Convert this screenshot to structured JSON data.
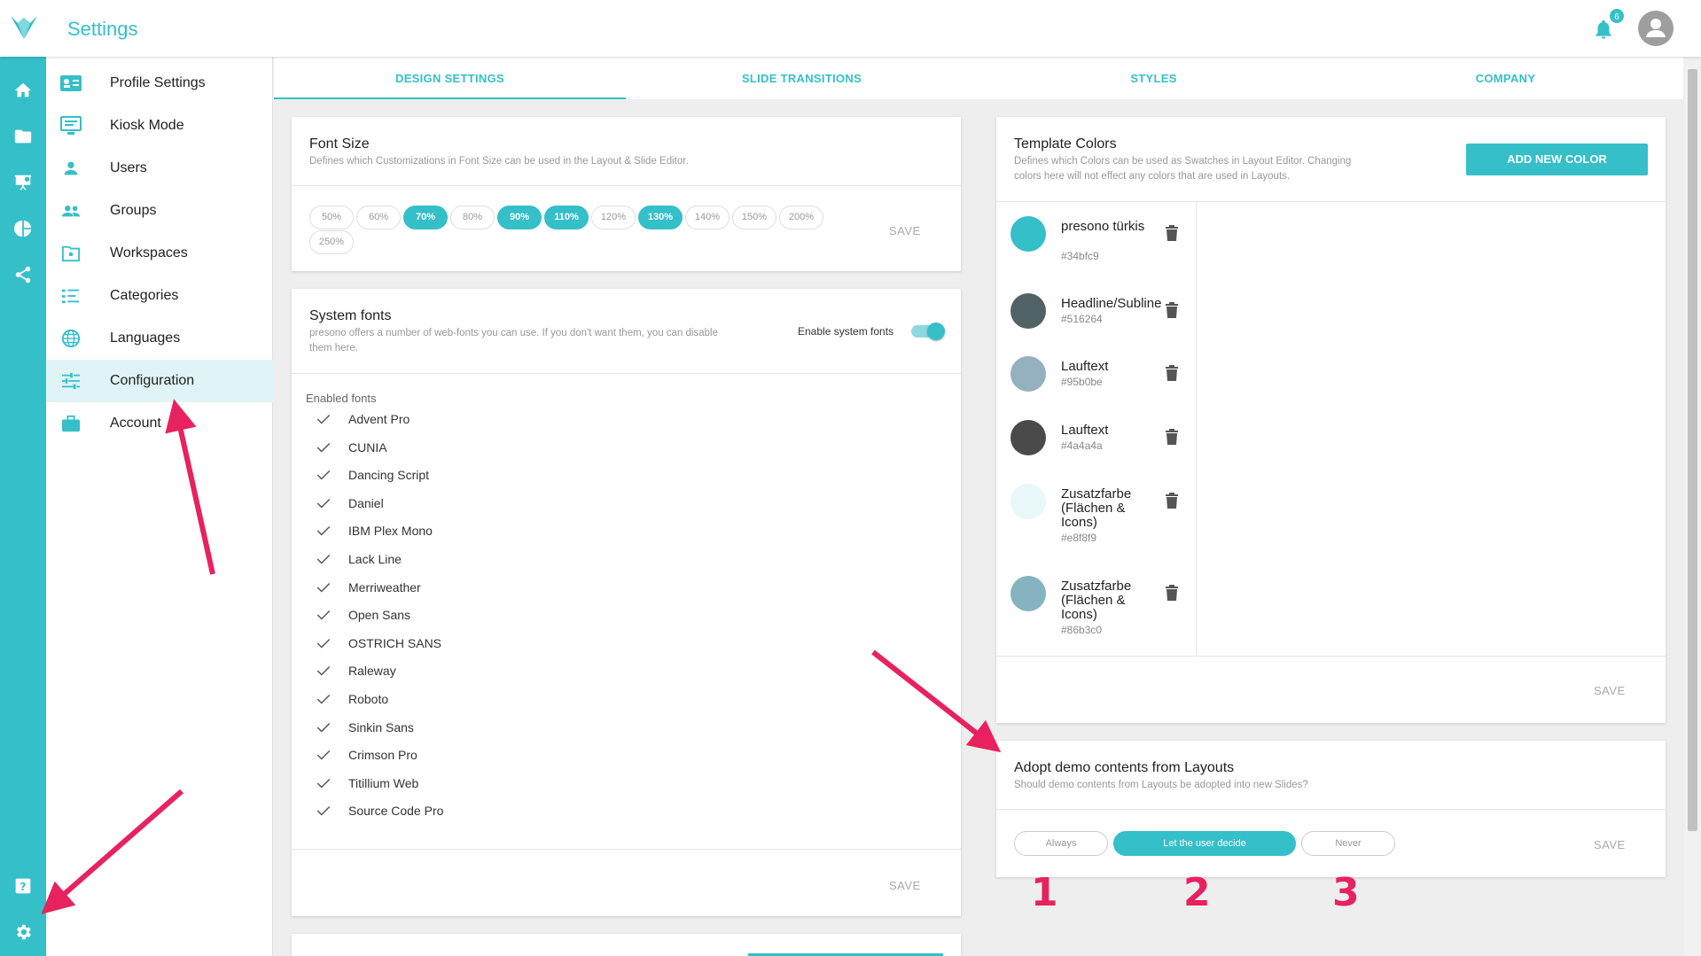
{
  "app": {
    "title": "Settings",
    "notification_count": "6"
  },
  "colors": {
    "accent": "#34bfc9",
    "annotation": "#e8215f"
  },
  "rail": [
    {
      "icon": "home-icon"
    },
    {
      "icon": "folder-icon"
    },
    {
      "icon": "presentation-icon"
    },
    {
      "icon": "pie-chart-icon"
    },
    {
      "icon": "share-icon"
    },
    {
      "icon": "help-icon"
    },
    {
      "icon": "gear-icon"
    }
  ],
  "sidebar": {
    "items": [
      {
        "label": "Profile Settings",
        "icon": "profile-card-icon"
      },
      {
        "label": "Kiosk Mode",
        "icon": "monitor-icon"
      },
      {
        "label": "Users",
        "icon": "user-icon"
      },
      {
        "label": "Groups",
        "icon": "group-icon"
      },
      {
        "label": "Workspaces",
        "icon": "workspace-folder-icon"
      },
      {
        "label": "Categories",
        "icon": "list-icon"
      },
      {
        "label": "Languages",
        "icon": "globe-icon"
      },
      {
        "label": "Configuration",
        "icon": "sliders-icon",
        "active": true
      },
      {
        "label": "Account",
        "icon": "briefcase-icon"
      }
    ]
  },
  "tabs": [
    {
      "label": "DESIGN SETTINGS",
      "active": true
    },
    {
      "label": "SLIDE TRANSITIONS"
    },
    {
      "label": "STYLES"
    },
    {
      "label": "COMPANY"
    }
  ],
  "font_size": {
    "title": "Font Size",
    "subtitle": "Defines which Customizations in Font Size can be used in the Layout & Slide Editor.",
    "options": [
      {
        "label": "50%",
        "on": false
      },
      {
        "label": "60%",
        "on": false
      },
      {
        "label": "70%",
        "on": true
      },
      {
        "label": "80%",
        "on": false
      },
      {
        "label": "90%",
        "on": true
      },
      {
        "label": "110%",
        "on": true
      },
      {
        "label": "120%",
        "on": false
      },
      {
        "label": "130%",
        "on": true
      },
      {
        "label": "140%",
        "on": false
      },
      {
        "label": "150%",
        "on": false
      },
      {
        "label": "200%",
        "on": false
      },
      {
        "label": "250%",
        "on": false
      }
    ],
    "save": "SAVE"
  },
  "system_fonts": {
    "title": "System fonts",
    "subtitle_1": "presono offers a number of web-fonts you can use. If you don't want them, you can disable",
    "subtitle_2": "them here.",
    "toggle_label": "Enable system fonts",
    "enabled_label": "Enabled fonts",
    "fonts": [
      "Advent Pro",
      "CUNIA",
      "Dancing Script",
      "Daniel",
      "IBM Plex Mono",
      "Lack Line",
      "Merriweather",
      "Open Sans",
      "OSTRICH SANS",
      "Raleway",
      "Roboto",
      "Sinkin Sans",
      "Crimson Pro",
      "Titillium Web",
      "Source Code Pro"
    ],
    "save": "SAVE"
  },
  "template_colors": {
    "title": "Template Colors",
    "subtitle_1": "Defines which Colors can be used as Swatches in Layout Editor. Changing",
    "subtitle_2": "colors here will not effect any colors that are used in Layouts.",
    "add_button": "ADD NEW COLOR",
    "colors": [
      {
        "name": "presono türkis",
        "hex": "#34bfc9"
      },
      {
        "name": "Headline/Subline",
        "hex": "#516264"
      },
      {
        "name": "Lauftext",
        "hex": "#95b0be"
      },
      {
        "name": "Lauftext",
        "hex": "#4a4a4a"
      },
      {
        "name": "Zusatzfarbe (Flächen & Icons)",
        "hex": "#e8f8f9"
      },
      {
        "name": "Zusatzfarbe (Flächen & Icons)",
        "hex": "#86b3c0"
      }
    ],
    "save": "SAVE"
  },
  "demo_contents": {
    "title": "Adopt demo contents from Layouts",
    "subtitle": "Should demo contents from Layouts be adopted into new Slides?",
    "options": [
      {
        "label": "Always",
        "on": false
      },
      {
        "label": "Let the user decide",
        "on": true
      },
      {
        "label": "Never",
        "on": false
      }
    ],
    "save": "SAVE"
  },
  "annotations": [
    "1",
    "2",
    "3"
  ]
}
